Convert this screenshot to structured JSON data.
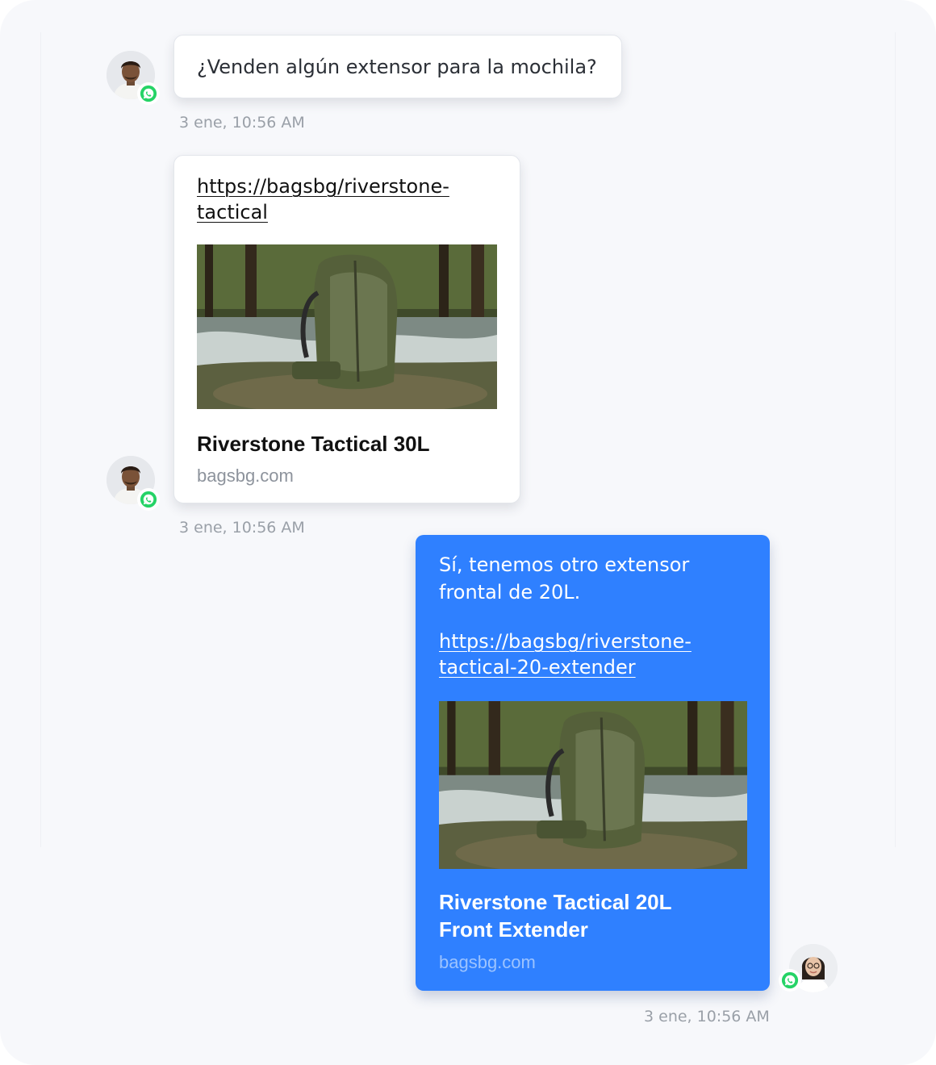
{
  "messages": [
    {
      "text": "¿Venden algún extensor para la mochila?",
      "timestamp": "3 ene, 10:56 AM"
    },
    {
      "link": "https://bagsbg/riverstone-tactical",
      "card_title": "Riverstone Tactical 30L",
      "card_domain": "bagsbg.com",
      "timestamp": "3 ene, 10:56 AM"
    },
    {
      "text": "Sí, tenemos otro extensor frontal de 20L.",
      "link": "https://bagsbg/riverstone-tactical-20-extender",
      "card_title": "Riverstone Tactical 20L Front Extender",
      "card_domain": "bagsbg.com",
      "timestamp": "3 ene, 10:56 AM"
    }
  ],
  "colors": {
    "outgoing_bubble": "#2f80ff",
    "incoming_bubble": "#ffffff",
    "whatsapp": "#25d366",
    "background": "#f7f8fb"
  },
  "icons": {
    "channel": "whatsapp-icon"
  }
}
